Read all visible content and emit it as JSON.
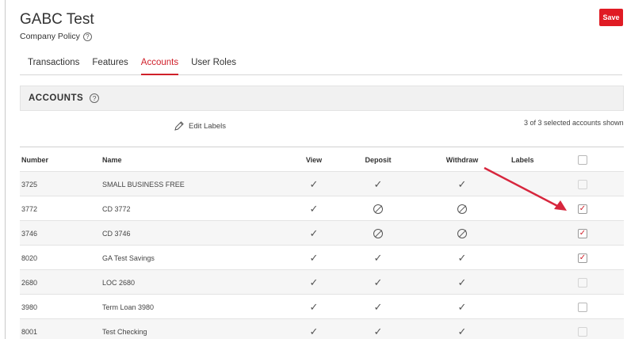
{
  "header": {
    "title": "GABC Test",
    "subtitle": "Company Policy",
    "help_glyph": "?",
    "save_label": "Save"
  },
  "tabs": [
    {
      "label": "Transactions",
      "active": false
    },
    {
      "label": "Features",
      "active": false
    },
    {
      "label": "Accounts",
      "active": true
    },
    {
      "label": "User Roles",
      "active": false
    }
  ],
  "section": {
    "title": "ACCOUNTS",
    "help_glyph": "?",
    "edit_labels": "Edit Labels",
    "shown_count": "3 of 3 selected accounts shown"
  },
  "table": {
    "columns": {
      "number": "Number",
      "name": "Name",
      "view": "View",
      "deposit": "Deposit",
      "withdraw": "Withdraw",
      "labels": "Labels"
    },
    "rows": [
      {
        "number": "3725",
        "name": "SMALL BUSINESS FREE",
        "view": "check",
        "deposit": "check",
        "withdraw": "check",
        "selected": false,
        "enabled": false
      },
      {
        "number": "3772",
        "name": "CD 3772",
        "view": "check",
        "deposit": "none",
        "withdraw": "none",
        "selected": true,
        "enabled": true
      },
      {
        "number": "3746",
        "name": "CD 3746",
        "view": "check",
        "deposit": "none",
        "withdraw": "none",
        "selected": true,
        "enabled": true
      },
      {
        "number": "8020",
        "name": "GA Test Savings",
        "view": "check",
        "deposit": "check",
        "withdraw": "check",
        "selected": true,
        "enabled": true
      },
      {
        "number": "2680",
        "name": "LOC 2680",
        "view": "check",
        "deposit": "check",
        "withdraw": "check",
        "selected": false,
        "enabled": false
      },
      {
        "number": "3980",
        "name": "Term Loan 3980",
        "view": "check",
        "deposit": "check",
        "withdraw": "check",
        "selected": false,
        "enabled": true
      },
      {
        "number": "8001",
        "name": "Test Checking",
        "view": "check",
        "deposit": "check",
        "withdraw": "check",
        "selected": false,
        "enabled": false
      }
    ]
  },
  "colors": {
    "accent": "#d0202a",
    "save_button": "#e01b24",
    "annotation_arrow": "#d7263d"
  },
  "icons": {
    "check": "check-icon",
    "none": "not-allowed-icon",
    "edit": "pencil-icon"
  }
}
